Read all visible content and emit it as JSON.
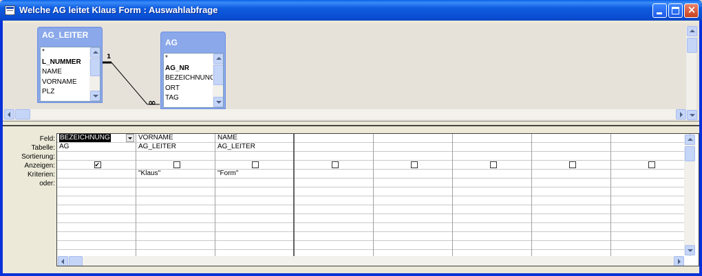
{
  "window": {
    "title": "Welche AG leitet Klaus Form : Auswahlabfrage"
  },
  "tables": [
    {
      "name": "AG_LEITER",
      "fields": [
        "*",
        "L_NUMMER",
        "NAME",
        "VORNAME",
        "PLZ"
      ],
      "key_field": "L_NUMMER"
    },
    {
      "name": "AG",
      "fields": [
        "*",
        "AG_NR",
        "BEZEICHNUNG",
        "ORT",
        "TAG"
      ],
      "key_field": "AG_NR"
    }
  ],
  "relationship": {
    "one_side": "1",
    "many_side": "∞"
  },
  "grid": {
    "row_labels": [
      "Feld:",
      "Tabelle:",
      "Sortierung:",
      "Anzeigen:",
      "Kriterien:",
      "oder:"
    ],
    "columns": [
      {
        "feld": "BEZEICHNUNG",
        "tabelle": "AG",
        "sortierung": "",
        "anzeigen": true,
        "kriterien": "",
        "oder": ""
      },
      {
        "feld": "VORNAME",
        "tabelle": "AG_LEITER",
        "sortierung": "",
        "anzeigen": false,
        "kriterien": "\"Klaus\"",
        "oder": ""
      },
      {
        "feld": "NAME",
        "tabelle": "AG_LEITER",
        "sortierung": "",
        "anzeigen": false,
        "kriterien": "\"Form\"",
        "oder": ""
      },
      {
        "feld": "",
        "tabelle": "",
        "sortierung": "",
        "anzeigen": false,
        "kriterien": "",
        "oder": ""
      },
      {
        "feld": "",
        "tabelle": "",
        "sortierung": "",
        "anzeigen": false,
        "kriterien": "",
        "oder": ""
      },
      {
        "feld": "",
        "tabelle": "",
        "sortierung": "",
        "anzeigen": false,
        "kriterien": "",
        "oder": ""
      },
      {
        "feld": "",
        "tabelle": "",
        "sortierung": "",
        "anzeigen": false,
        "kriterien": "",
        "oder": ""
      },
      {
        "feld": "",
        "tabelle": "",
        "sortierung": "",
        "anzeigen": false,
        "kriterien": "",
        "oder": ""
      }
    ]
  },
  "icons": {
    "app": "query-icon",
    "minimize": "minimize-icon",
    "maximize": "maximize-icon",
    "close": "close-icon"
  },
  "colors": {
    "titlebar": "#0a4fd4",
    "table_header": "#8aa8ea",
    "close_button": "#c9401e"
  }
}
